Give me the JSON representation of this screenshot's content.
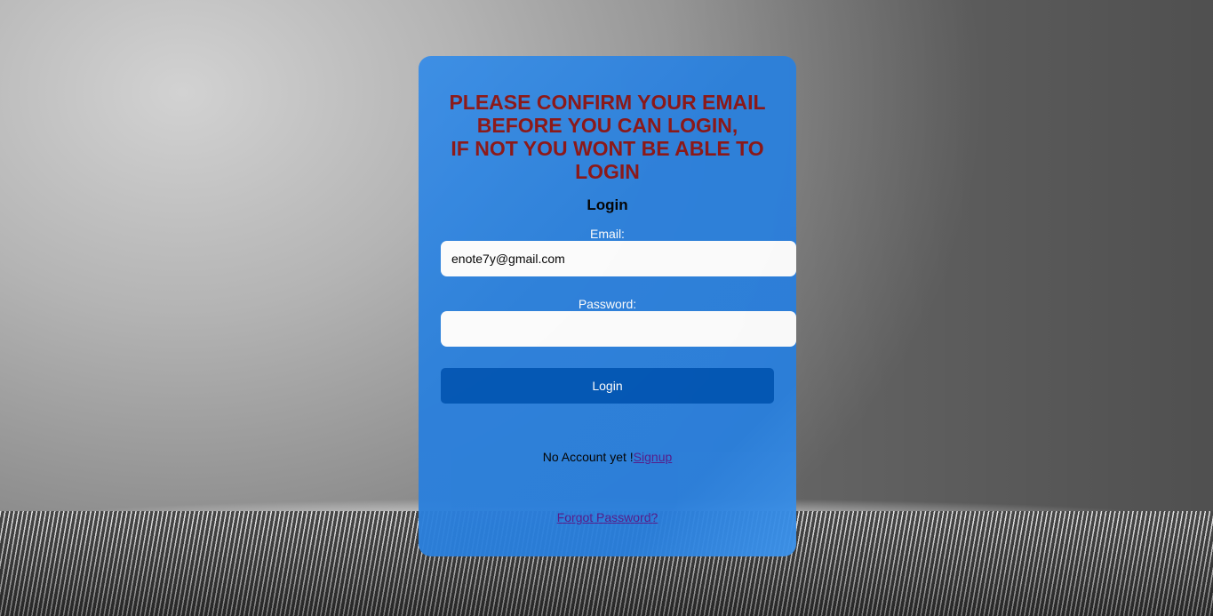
{
  "warning": {
    "line1": "PLEASE CONFIRM YOUR EMAIL",
    "line2": "BEFORE YOU CAN LOGIN,",
    "line3": "IF NOT YOU WONT BE ABLE TO",
    "line4": "LOGIN"
  },
  "form": {
    "title": "Login",
    "email_label": "Email:",
    "email_value": "enote7y@gmail.com",
    "password_label": "Password:",
    "password_value": "",
    "submit_label": "Login"
  },
  "footer": {
    "no_account_text": "No Account yet !",
    "signup_link": "Signup",
    "forgot_link": "Forgot Password?"
  },
  "colors": {
    "card": "#2b80dc",
    "warning_text": "#8b1414",
    "button": "#0056b6",
    "link": "#551a8b"
  }
}
